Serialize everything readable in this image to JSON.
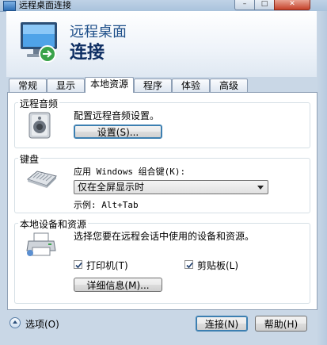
{
  "window": {
    "title": "远程桌面连接"
  },
  "header": {
    "line1": "远程桌面",
    "line2": "连接"
  },
  "tabs": [
    {
      "label": "常规"
    },
    {
      "label": "显示"
    },
    {
      "label": "本地资源",
      "active": true
    },
    {
      "label": "程序"
    },
    {
      "label": "体验"
    },
    {
      "label": "高级"
    }
  ],
  "audio": {
    "legend": "远程音频",
    "description": "配置远程音频设置。",
    "settings_button": "设置(S)..."
  },
  "keyboard": {
    "legend": "键盘",
    "label": "应用 Windows 组合键(K):",
    "selected": "仅在全屏显示时",
    "example": "示例: Alt+Tab"
  },
  "devices": {
    "legend": "本地设备和资源",
    "description": "选择您要在远程会话中使用的设备和资源。",
    "printers": {
      "label": "打印机(T)",
      "checked": true
    },
    "clipboard": {
      "label": "剪贴板(L)",
      "checked": true
    },
    "more_button": "详细信息(M)..."
  },
  "footer": {
    "options": "选项(O)",
    "connect": "连接(N)",
    "help": "帮助(H)"
  },
  "colors": {
    "accent": "#1d4e89",
    "frame": "#c9d7e6",
    "focus": "#3c7fb1"
  }
}
